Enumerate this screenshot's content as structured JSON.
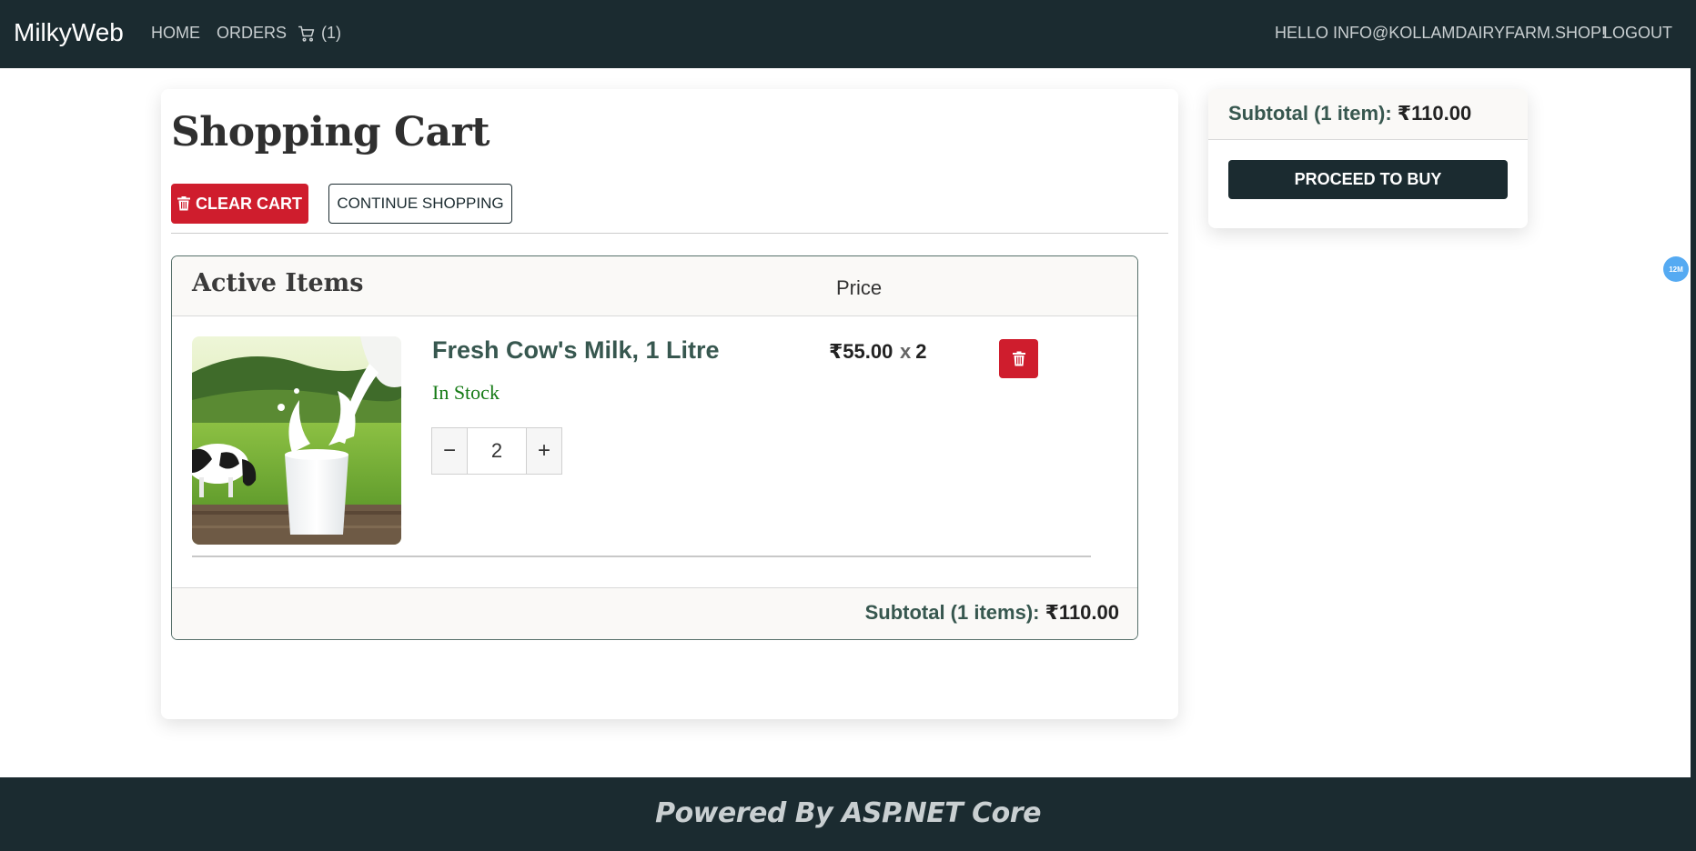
{
  "navbar": {
    "brand": "MilkyWeb",
    "home": "HOME",
    "orders": "ORDERS",
    "cart_count": "(1)",
    "cart_icon": "cart-icon",
    "greeting": "HELLO INFO@KOLLAMDAIRYFARM.SHOP!",
    "logout": "LOGOUT"
  },
  "cart": {
    "title": "Shopping Cart",
    "clear_label": "CLEAR CART",
    "continue_label": "CONTINUE SHOPPING",
    "active_items_title": "Active Items",
    "price_header": "Price",
    "items": [
      {
        "name": "Fresh Cow's Milk, 1 Litre",
        "stock": "In Stock",
        "quantity": "2",
        "unit_price": "₹55.00",
        "qty_prefix": "x",
        "image_icon": "milk-product-image"
      }
    ],
    "subtotal_label": "Subtotal (1 items):",
    "subtotal_amount": "₹110.00"
  },
  "summary": {
    "subtotal_label": "Subtotal (1 item):",
    "subtotal_amount": "₹110.00",
    "proceed_label": "PROCEED TO BUY"
  },
  "badge": "12M",
  "footer": {
    "text": "Powered By ASP.NET Core"
  },
  "colors": {
    "navbar": "#1b2b30",
    "danger": "#cf1d2d",
    "accent_green": "#37574f",
    "stock_green": "#157a15"
  }
}
